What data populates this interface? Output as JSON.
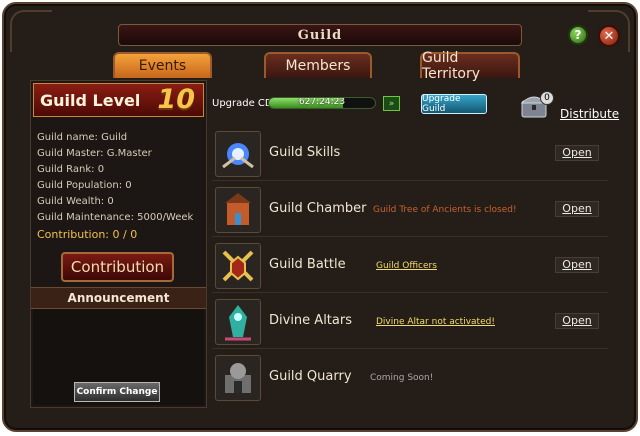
{
  "window": {
    "title": "Guild"
  },
  "tabs": [
    {
      "label": "Events",
      "active": true
    },
    {
      "label": "Members",
      "active": false
    },
    {
      "label": "Guild Territory",
      "active": false
    }
  ],
  "left_panel": {
    "level_label": "Guild Level",
    "level_value": "10",
    "info": {
      "name": "Guild name:  Guild",
      "master": "Guild Master:  G.Master",
      "rank": "Guild Rank:  0",
      "population": "Guild Population:  0",
      "wealth": "Guild Wealth:  0",
      "maintenance": "Guild Maintenance: 5000/Week",
      "contribution": "Contribution:  0 / 0"
    },
    "contribution_button": "Contribution",
    "announcement_header": "Announcement",
    "confirm_change_button": "Confirm Change"
  },
  "upgrade": {
    "label": "Upgrade CD",
    "countdown": "627:24:23",
    "progress": 0.7,
    "speedup_icon": "double-arrow-right-icon",
    "button_label": "Upgrade Guild",
    "chest_count": "0",
    "distribute_label": "Distribute"
  },
  "features": [
    {
      "name": "Guild Skills",
      "status": "",
      "status_style": "none",
      "action": "Open",
      "icon": "skills-orb-icon"
    },
    {
      "name": "Guild Chamber",
      "status": "Guild Tree of Ancients is closed!",
      "status_style": "red",
      "action": "Open",
      "icon": "chamber-icon"
    },
    {
      "name": "Guild Battle",
      "status": "Guild Officers",
      "status_style": "link",
      "action": "Open",
      "icon": "crossed-swords-icon"
    },
    {
      "name": "Divine Altars",
      "status": "Divine Altar not activated!",
      "status_style": "link",
      "action": "Open",
      "icon": "altar-icon"
    },
    {
      "name": "Guild Quarry",
      "status": "Coming Soon!",
      "status_style": "gray",
      "action": "",
      "icon": "quarry-icon"
    }
  ],
  "colors": {
    "accent": "#f3a13b",
    "title_bar": "#3a1514",
    "level_gold": "#f6c64a",
    "link": "#f2dd6b",
    "warn": "#c8632f"
  }
}
